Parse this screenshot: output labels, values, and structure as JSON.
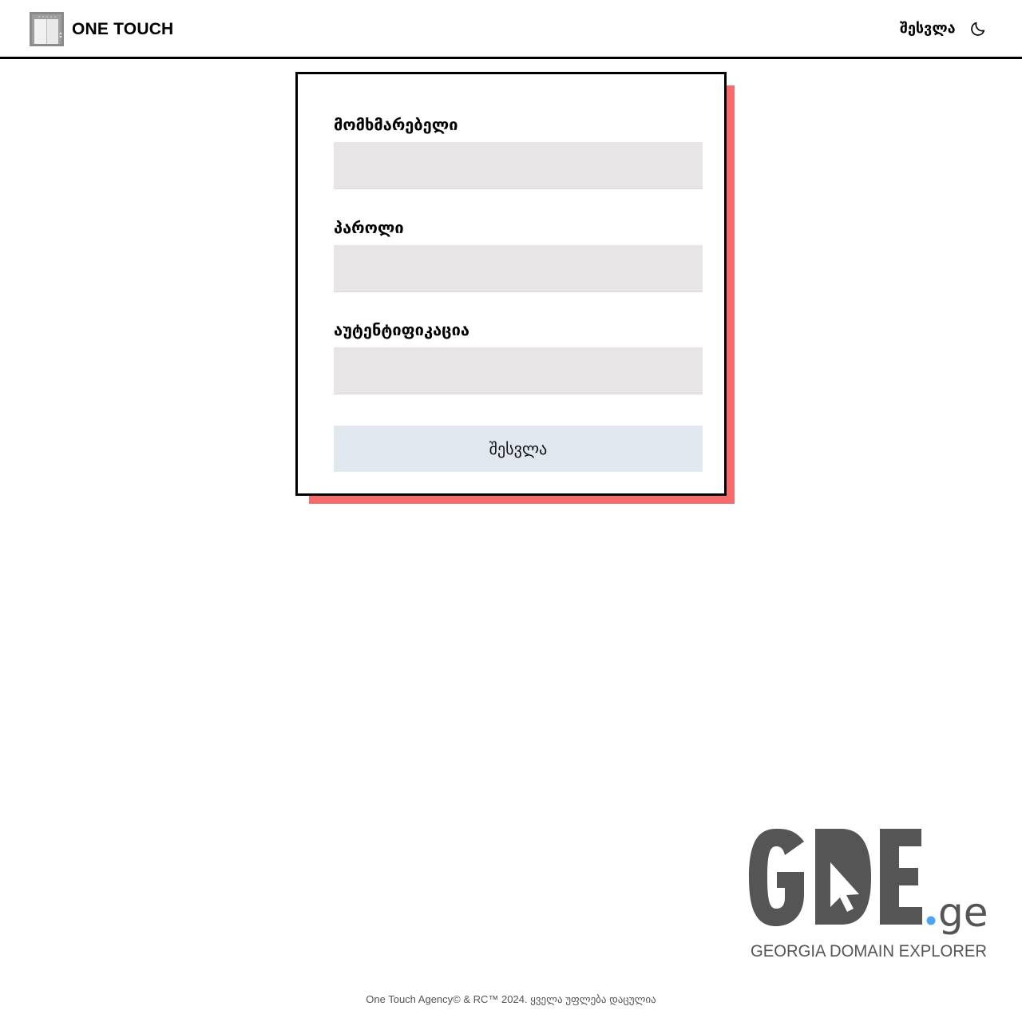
{
  "header": {
    "brand_name": "ONE TOUCH",
    "login_link": "შესვლა",
    "theme_icon": "moon-icon"
  },
  "form": {
    "username_label": "მომხმარებელი",
    "password_label": "პაროლი",
    "auth_label": "აუტენტიფიკაცია",
    "username_value": "",
    "password_value": "",
    "auth_value": "",
    "submit_label": "შესვლა"
  },
  "gde_logo": {
    "name_text": "GDE",
    "suffix_text": "ge",
    "tagline": "GEORGIA DOMAIN EXPLORER"
  },
  "footer": {
    "text": "One Touch Agency© & RC™ 2024. ყველა უფლება დაცულია"
  },
  "colors": {
    "accent_shadow": "#f66b6b",
    "input_bg": "#e7e5e5",
    "button_bg": "#e2e8f0",
    "gde_dark": "#555555",
    "gde_dot": "#4da3f5"
  }
}
